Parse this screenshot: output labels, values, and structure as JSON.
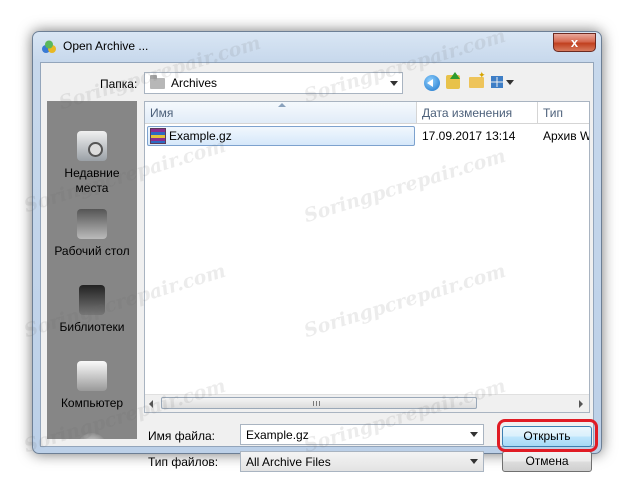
{
  "window": {
    "title": "Open Archive ...",
    "close_glyph": "x"
  },
  "toolbar": {
    "lookin_label": "Папка:",
    "lookin_value": "Archives"
  },
  "places": [
    {
      "label": "Недавние места",
      "icon": "recent-places-icon"
    },
    {
      "label": "Рабочий стол",
      "icon": "desktop-icon"
    },
    {
      "label": "Библиотеки",
      "icon": "libraries-icon"
    },
    {
      "label": "Компьютер",
      "icon": "computer-icon"
    },
    {
      "label": "",
      "icon": "network-icon"
    }
  ],
  "filelist": {
    "columns": {
      "name": "Имя",
      "date": "Дата изменения",
      "type": "Тип"
    },
    "rows": [
      {
        "name": "Example.gz",
        "date": "17.09.2017 13:14",
        "type": "Архив Wi"
      }
    ],
    "scroll_grip": "III"
  },
  "form": {
    "filename_label": "Имя файла:",
    "filename_value": "Example.gz",
    "filetype_label": "Тип файлов:",
    "filetype_value": "All Archive Files",
    "open_label": "Открыть",
    "cancel_label": "Отмена"
  },
  "watermark": "Soringpcrepair.com",
  "colors": {
    "highlight_ring": "#e01b24",
    "places_bg": "#868686",
    "selection": "#d6e8fa"
  }
}
